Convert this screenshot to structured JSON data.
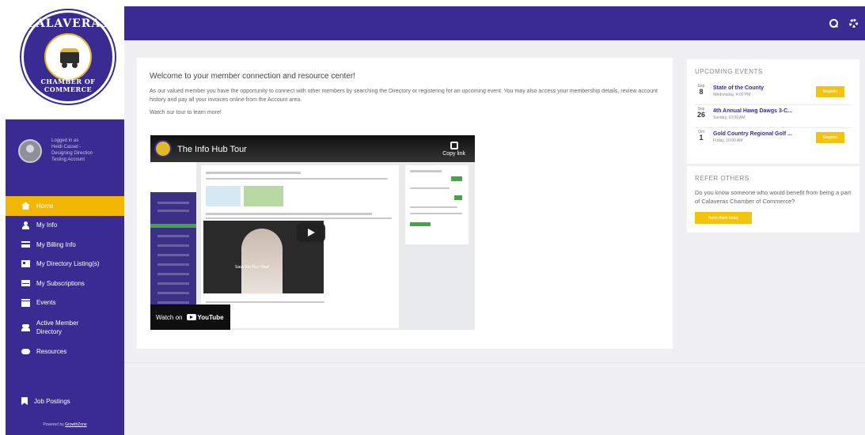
{
  "brand": {
    "seal_top": "CALAVERAS",
    "seal_bottom": "CHAMBER OF COMMERCE",
    "primary_color": "#3a2b92",
    "accent_color": "#f2b705"
  },
  "user": {
    "line1": "Logged in as",
    "line2": "Heidi Cassel -",
    "line3": "Designing Direction",
    "line4": "Testing Account"
  },
  "nav": {
    "items": [
      {
        "label": "Home",
        "icon": "home-icon",
        "active": true
      },
      {
        "label": "My Info",
        "icon": "user-icon"
      },
      {
        "label": "My Billing Info",
        "icon": "credit-card-icon"
      },
      {
        "label": "My Directory Listing(s)",
        "icon": "directory-card-icon"
      },
      {
        "label": "My Subscriptions",
        "icon": "envelope-icon"
      },
      {
        "label": "Events",
        "icon": "calendar-icon"
      },
      {
        "label": "Active Member Directory",
        "icon": "group-icon"
      },
      {
        "label": "Resources",
        "icon": "cloud-icon"
      }
    ],
    "jobs_label": "Job Postings",
    "powered_prefix": "Powered by",
    "powered_link": "GrowthZone"
  },
  "topbar": {
    "search_icon": "search-icon",
    "settings_icon": "gear-icon"
  },
  "welcome": {
    "title": "Welcome to your member connection and resource center!",
    "body": "As our valued member you have the opportunity to connect with other members by searching the Directory or registering for an upcoming event. You may also access your membership details, review account history and pay all your invoices online from the Account area.",
    "tour": "Watch our tour to learn more!"
  },
  "video": {
    "title": "The Info Hub Tour",
    "copy_label": "Copy link",
    "inner_caption": "Save the Tour Now!",
    "watch_on": "Watch on",
    "youtube": "YouTube"
  },
  "events": {
    "title": "UPCOMING EVENTS",
    "items": [
      {
        "month": "Sep",
        "day": "8",
        "name": "State of the County",
        "time": "Wednesday, 4:00 PM",
        "button": "Register"
      },
      {
        "month": "Sep",
        "day": "26",
        "name": "4th Annual Hawg Dawgs 3-C...",
        "time": "Sunday, 10:00 AM",
        "button": ""
      },
      {
        "month": "Oct",
        "day": "1",
        "name": "Gold Country Regional Golf ...",
        "time": "Friday, 10:00 AM",
        "button": "Register"
      }
    ]
  },
  "refer": {
    "title": "REFER OTHERS",
    "text": "Do you know someone who would benefit from being a part of Calaveras Chamber of Commerce?",
    "button": "Refer them today"
  }
}
